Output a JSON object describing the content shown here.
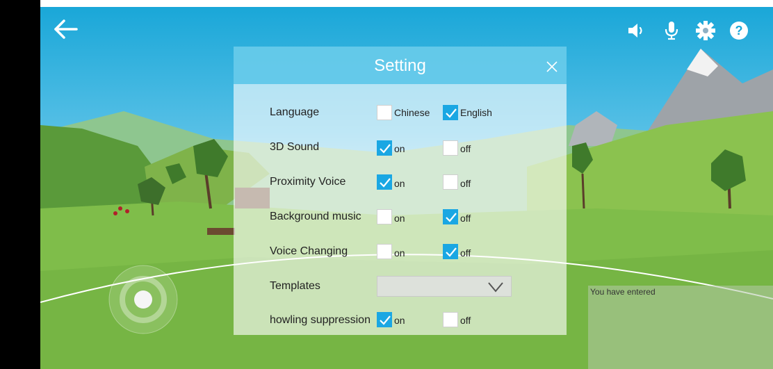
{
  "settings": {
    "title": "Setting",
    "language": {
      "label": "Language",
      "options": [
        {
          "label": "Chinese",
          "checked": false
        },
        {
          "label": "English",
          "checked": true
        }
      ]
    },
    "sound3d": {
      "label": "3D Sound",
      "options": [
        {
          "label": "on",
          "checked": true
        },
        {
          "label": "off",
          "checked": false
        }
      ]
    },
    "proximity_voice": {
      "label": "Proximity Voice",
      "options": [
        {
          "label": "on",
          "checked": true
        },
        {
          "label": "off",
          "checked": false
        }
      ]
    },
    "background_music": {
      "label": "Background music",
      "options": [
        {
          "label": "on",
          "checked": false
        },
        {
          "label": "off",
          "checked": true
        }
      ]
    },
    "voice_changing": {
      "label": "Voice Changing",
      "options": [
        {
          "label": "on",
          "checked": false
        },
        {
          "label": "off",
          "checked": true
        }
      ]
    },
    "templates": {
      "label": "Templates",
      "selected": ""
    },
    "howling_suppression": {
      "label": "howling suppression",
      "options": [
        {
          "label": "on",
          "checked": true
        },
        {
          "label": "off",
          "checked": false
        }
      ]
    }
  },
  "chat": {
    "text": "You have entered"
  },
  "icons": {
    "back": "back-arrow-icon",
    "speaker": "speaker-icon",
    "mic": "microphone-icon",
    "settings": "gear-icon",
    "help": "help-icon",
    "close": "close-icon",
    "dropdown": "chevron-down-icon"
  },
  "colors": {
    "checkbox_checked": "#1aa7e3",
    "header": "#56c4e8"
  }
}
